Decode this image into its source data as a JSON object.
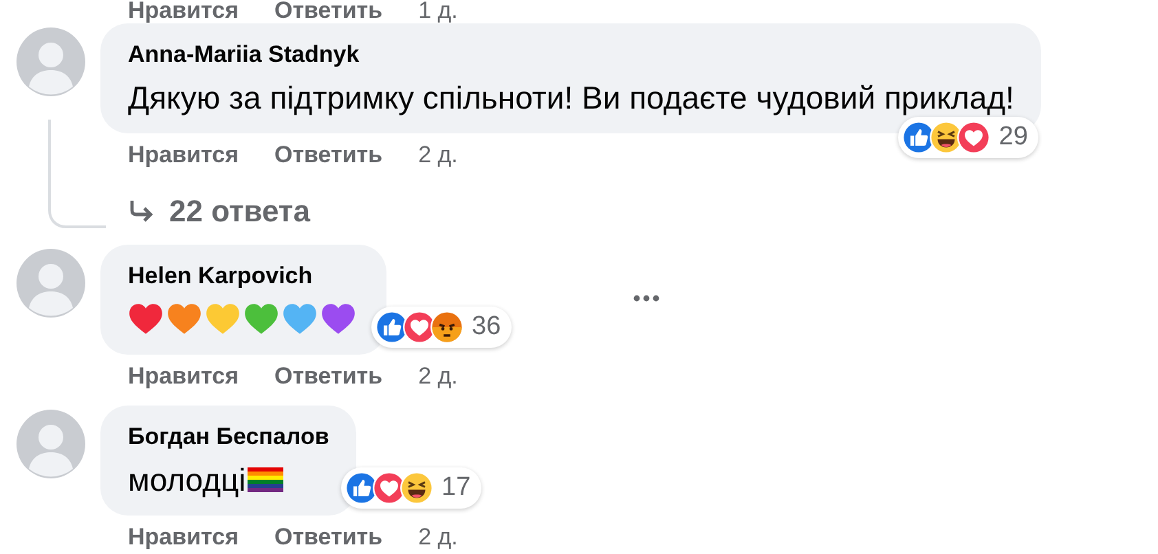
{
  "top_actions": {
    "like": "Нравится",
    "reply": "Ответить",
    "time": "1 д."
  },
  "comments": [
    {
      "author": "Anna-Mariia Stadnyk",
      "body": [
        {
          "kind": "text",
          "text": "Дякую за підтримку спільноти! Ви подаєте чудовий приклад!"
        }
      ],
      "reactions": [
        {
          "kind": "like"
        },
        {
          "kind": "haha"
        },
        {
          "kind": "love"
        }
      ],
      "reaction_count": "29",
      "more_button": false,
      "like": "Нравится",
      "reply": "Ответить",
      "time": "2 д.",
      "replies": "22 ответа"
    },
    {
      "author": "Helen Karpovich",
      "body": [
        {
          "kind": "heart",
          "color": "#f0283c"
        },
        {
          "kind": "heart",
          "color": "#f7821e"
        },
        {
          "kind": "heart",
          "color": "#fcc934"
        },
        {
          "kind": "heart",
          "color": "#4cbf3c"
        },
        {
          "kind": "heart",
          "color": "#54b4f4"
        },
        {
          "kind": "heart",
          "color": "#9b4cf0"
        }
      ],
      "reactions": [
        {
          "kind": "like"
        },
        {
          "kind": "love"
        },
        {
          "kind": "angry"
        }
      ],
      "reaction_count": "36",
      "more_button": true,
      "like": "Нравится",
      "reply": "Ответить",
      "time": "2 д."
    },
    {
      "author": "Богдан Беспалов",
      "body": [
        {
          "kind": "text",
          "text": "молодці"
        },
        {
          "kind": "flag"
        }
      ],
      "reactions": [
        {
          "kind": "like"
        },
        {
          "kind": "love"
        },
        {
          "kind": "haha"
        }
      ],
      "reaction_count": "17",
      "more_button": false,
      "like": "Нравится",
      "reply": "Ответить",
      "time": "2 д."
    }
  ]
}
